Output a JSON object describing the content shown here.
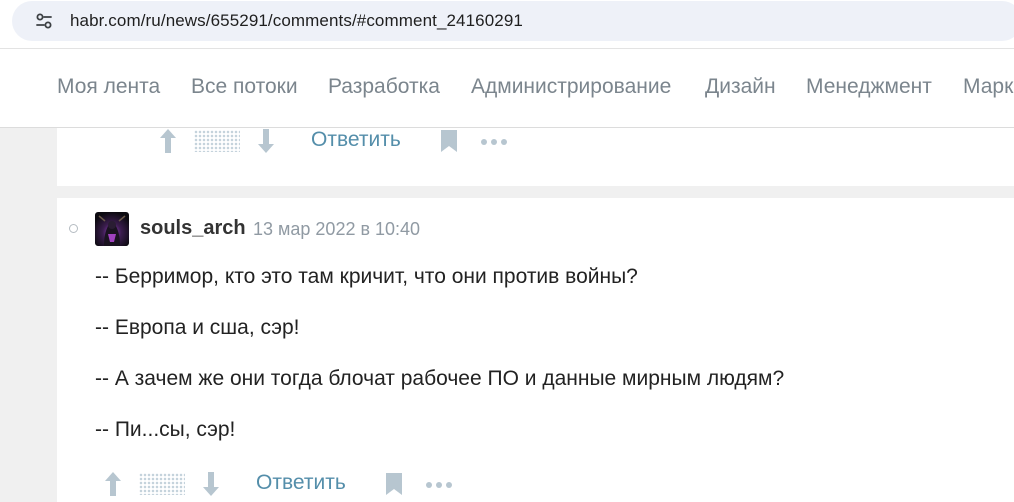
{
  "browser": {
    "url": "habr.com/ru/news/655291/comments/#comment_24160291",
    "site_icon": "tune-icon"
  },
  "nav": {
    "items": [
      "Моя лента",
      "Все потоки",
      "Разработка",
      "Администрирование",
      "Дизайн",
      "Менеджмент",
      "Марк"
    ]
  },
  "prev_comment": {
    "reply_label": "Ответить"
  },
  "comment": {
    "author": "souls_arch",
    "date": "13 мар 2022 в 10:40",
    "lines": [
      "-- Берримор, кто это там кричит, что они против войны?",
      "-- Европа и сша, сэр!",
      "-- А зачем же они тогда блочат рабочее ПО и данные мирным людям?",
      "-- Пи...сы, сэр!"
    ],
    "reply_label": "Ответить"
  },
  "colors": {
    "nav_text": "#7b858d",
    "reply_link": "#548eaa",
    "vote_icon": "#b7c6d0",
    "page_gutter": "#f0f0f0"
  }
}
